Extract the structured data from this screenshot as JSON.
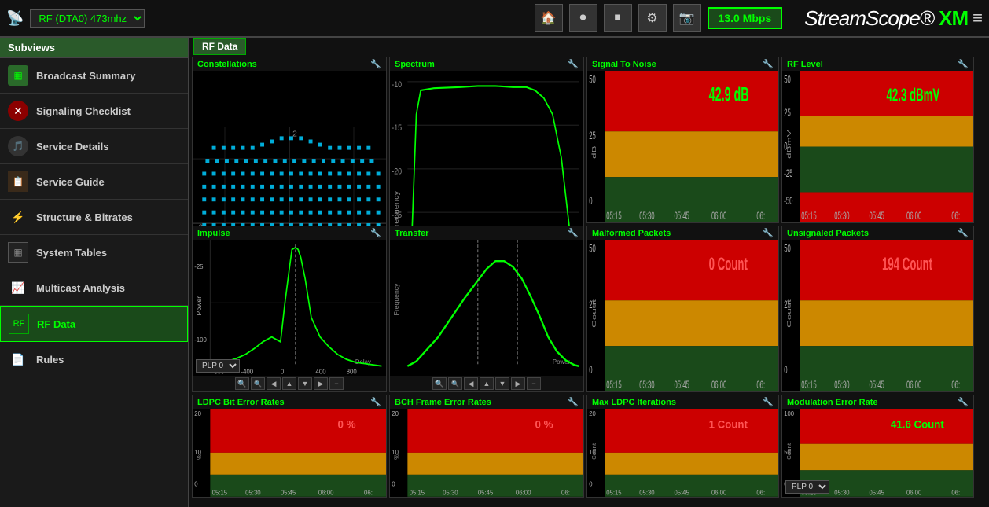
{
  "header": {
    "signal_icon": "📡",
    "title": "RF (DTA0) 473mhz",
    "home_icon": "🏠",
    "record_icon": "⏺",
    "stop_icon": "⏹",
    "settings_icon": "⚙",
    "camera_icon": "📷",
    "bitrate": "13.0 Mbps",
    "logo_text": "StreamScope",
    "logo_accent": "XM",
    "menu_icon": "≡"
  },
  "sidebar": {
    "header": "Subviews",
    "items": [
      {
        "id": "broadcast-summary",
        "label": "Broadcast Summary",
        "icon": "📊",
        "active": false
      },
      {
        "id": "signaling-checklist",
        "label": "Signaling Checklist",
        "icon": "❌",
        "active": false
      },
      {
        "id": "service-details",
        "label": "Service Details",
        "icon": "🎵",
        "active": false
      },
      {
        "id": "service-guide",
        "label": "Service Guide",
        "icon": "📋",
        "active": false
      },
      {
        "id": "structure-bitrates",
        "label": "Structure & Bitrates",
        "icon": "⚡",
        "active": false
      },
      {
        "id": "system-tables",
        "label": "System Tables",
        "icon": "📱",
        "active": false
      },
      {
        "id": "multicast-analysis",
        "label": "Multicast Analysis",
        "icon": "📈",
        "active": false
      },
      {
        "id": "rf-data",
        "label": "RF Data",
        "icon": "📡",
        "active": true
      },
      {
        "id": "rules",
        "label": "Rules",
        "icon": "📄",
        "active": false
      }
    ]
  },
  "content": {
    "section_title": "RF Data",
    "panels": {
      "constellations": {
        "title": "Constellations",
        "plp": "PLP 0"
      },
      "spectrum": {
        "title": "Spectrum"
      },
      "signal_to_noise": {
        "title": "Signal To Noise",
        "value": "42.9 dB",
        "value_color": "green"
      },
      "rf_level": {
        "title": "RF Level",
        "value": "42.3 dBmV",
        "value_color": "green"
      },
      "malformed_packets": {
        "title": "Malformed Packets",
        "value": "0 Count",
        "value_color": "red"
      },
      "unsignaled_packets": {
        "title": "Unsignaled Packets",
        "value": "194 Count",
        "value_color": "red"
      },
      "impulse": {
        "title": "Impulse"
      },
      "transfer": {
        "title": "Transfer"
      },
      "ldpc_ber": {
        "title": "LDPC Bit Error Rates",
        "value": "0 %",
        "value_color": "red"
      },
      "bch_fer": {
        "title": "BCH Frame Error Rates",
        "value": "0 %",
        "value_color": "red"
      },
      "max_ldpc": {
        "title": "Max LDPC Iterations",
        "value": "1 Count",
        "value_color": "red"
      },
      "mer": {
        "title": "Modulation Error Rate",
        "value": "41.6 Count",
        "value_color": "green",
        "plp": "PLP 0"
      }
    },
    "time_labels": [
      "05:15",
      "05:30",
      "05:45",
      "06:00",
      "06:"
    ],
    "buttons": [
      "🔍",
      "🔍",
      "◀",
      "⬆",
      "⬇",
      "▶",
      "➖"
    ]
  }
}
